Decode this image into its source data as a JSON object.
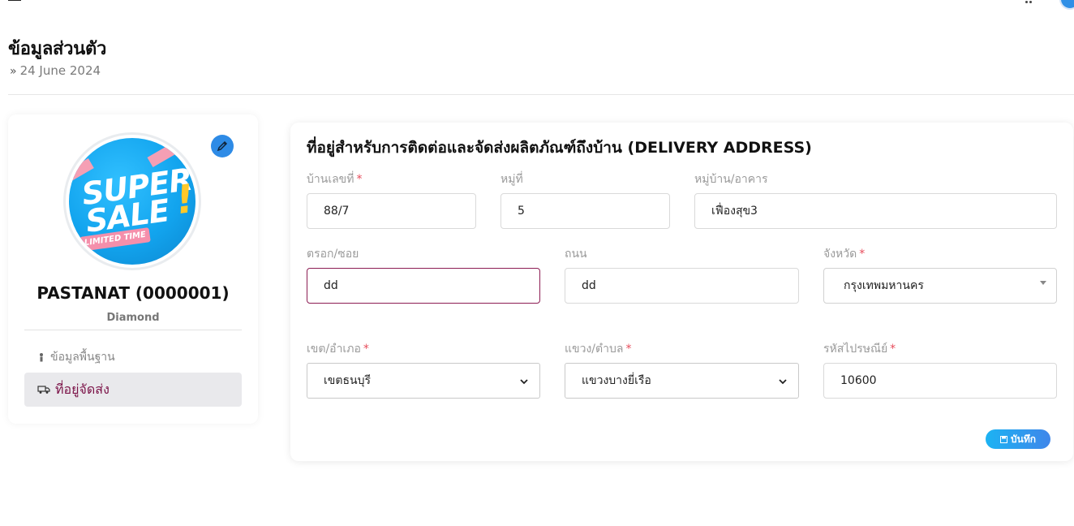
{
  "page": {
    "title": "ข้อมูลส่วนตัว",
    "date": "24 June 2024"
  },
  "profile": {
    "avatar_text": "SUPER SALE",
    "avatar_ribbon": "LIMITED TIME",
    "name": "PASTANAT (0000001)",
    "tier": "Diamond",
    "menu": [
      {
        "label": "ข้อมูลพื้นฐาน",
        "icon": "person-icon",
        "active": false
      },
      {
        "label": "ที่อยู่จัดส่ง",
        "icon": "truck-icon",
        "active": true
      }
    ]
  },
  "address_form": {
    "title": "ที่อยู่สำหรับการติดต่อและจัดส่งผลิตภัณฑ์ถึงบ้าน (DELIVERY ADDRESS)",
    "required_mark": "*",
    "fields": {
      "house_no": {
        "label": "บ้านเลขที่",
        "value": "88/7",
        "required": true
      },
      "moo": {
        "label": "หมู่ที่",
        "value": "5",
        "required": false
      },
      "village": {
        "label": "หมู่บ้าน/อาคาร",
        "value": "เฟื่องสุข3",
        "required": false
      },
      "soi": {
        "label": "ตรอก/ซอย",
        "value": "dd",
        "required": false
      },
      "road": {
        "label": "ถนน",
        "value": "dd",
        "required": false
      },
      "province": {
        "label": "จังหวัด",
        "value": "กรุงเทพมหานคร",
        "required": true
      },
      "district": {
        "label": "เขต/อำเภอ",
        "value": "เขตธนบุรี",
        "required": true
      },
      "subdistrict": {
        "label": "แขวง/ตำบล",
        "value": "แขวงบางยี่เรือ",
        "required": true
      },
      "postcode": {
        "label": "รหัสไปรษณีย์",
        "value": "10600",
        "required": true
      }
    },
    "save_label": "บันทึก"
  },
  "colors": {
    "accent_blue": "#2e8be6",
    "active_menu_text": "#7a1046",
    "focus_border": "#8c1c53",
    "required_star": "#e74c5b"
  }
}
